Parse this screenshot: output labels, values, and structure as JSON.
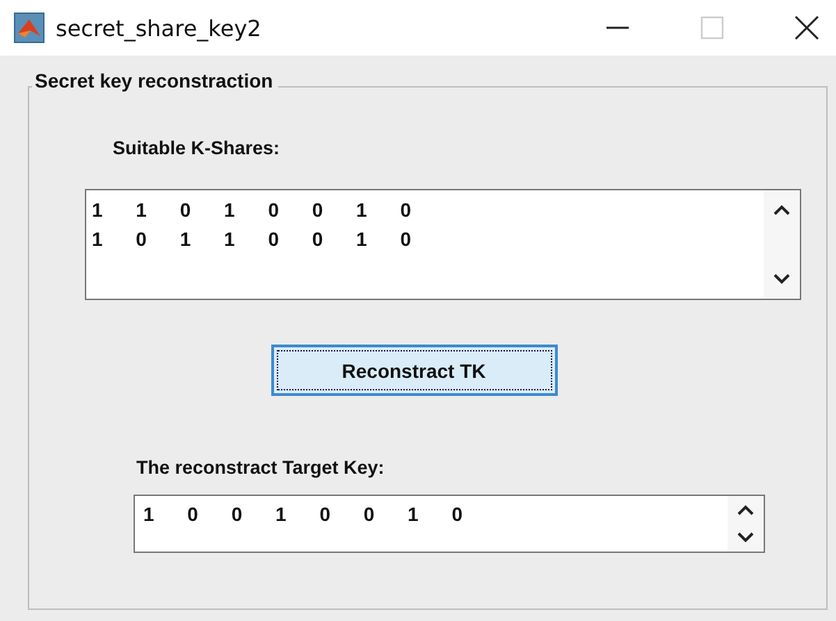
{
  "window": {
    "title": "secret_share_key2",
    "maximize_disabled": true
  },
  "panel": {
    "title": "Secret key reconstraction"
  },
  "shares": {
    "label": "Suitable K-Shares:",
    "rows": [
      "1 1 0 1 0 0 1 0",
      "1 0 1 1 0 0 1 0"
    ]
  },
  "button": {
    "label": "Reconstract TK",
    "focused": true
  },
  "target": {
    "label": "The reconstract Target Key:",
    "value": "1 0 0 1 0 0 1 0"
  }
}
